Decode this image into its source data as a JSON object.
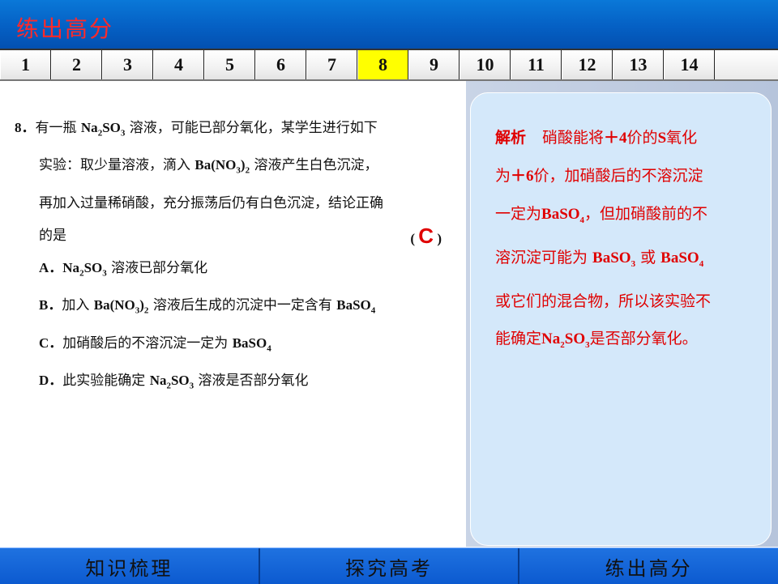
{
  "header": {
    "title": "练出高分"
  },
  "nav": {
    "items": [
      "1",
      "2",
      "3",
      "4",
      "5",
      "6",
      "7",
      "8",
      "9",
      "10",
      "11",
      "12",
      "13",
      "14"
    ],
    "active": "8"
  },
  "question": {
    "number": "8．",
    "l1_a": "有一瓶 ",
    "l1_chem": "Na",
    "l1_sub": "2",
    "l1_chem2": "SO",
    "l1_sub2": "3",
    "l1_b": " 溶液，可能已部分氧化，某学生进行如下",
    "l2_a": "实验：取少量溶液，滴入 ",
    "l2_chem": "Ba(NO",
    "l2_sub": "3",
    "l2_chem2": ")",
    "l2_sub2": "2",
    "l2_b": " 溶液产生白色沉淀，",
    "l3": "再加入过量稀硝酸，充分振荡后仍有白色沉淀，结论正确",
    "l4": "的是",
    "paren_open": "(",
    "answer": "C",
    "paren_close": ")",
    "options": {
      "a_label": "A．",
      "a_chem": "Na",
      "a_sub": "2",
      "a_chem2": "SO",
      "a_sub2": "3",
      "a_text": " 溶液已部分氧化",
      "b_label": "B．",
      "b_text1": "加入 ",
      "b_chem": "Ba(NO",
      "b_sub": "3",
      "b_chem2": ")",
      "b_sub2": "2",
      "b_text2": " 溶液后生成的沉淀中一定含有 ",
      "b_chem3": "BaSO",
      "b_sub3": "4",
      "c_label": "C．",
      "c_text": "加硝酸后的不溶沉淀一定为 ",
      "c_chem": "BaSO",
      "c_sub": "4",
      "d_label": "D．",
      "d_text1": "此实验能确定 ",
      "d_chem": "Na",
      "d_sub": "2",
      "d_chem2": "SO",
      "d_sub2": "3",
      "d_text2": " 溶液是否部分氧化"
    }
  },
  "analysis": {
    "label": "解析",
    "t1": "硝酸能将",
    "t1b": "＋4",
    "t1c": "价的",
    "t1d": "S",
    "t1e": "氧化",
    "t2": "为",
    "t2b": "＋6",
    "t2c": "价，加硝酸后的不溶沉淀",
    "t3": "一定为",
    "t3b": "BaSO",
    "t3s": "4",
    "t3c": "，但加硝酸前的不",
    "t4": "溶沉淀可能为 ",
    "t4b": "BaSO",
    "t4s": "3",
    "t4c": " 或 ",
    "t4d": "BaSO",
    "t4s2": "4",
    "t5": "或它们的混合物，所以该实验不",
    "t6": "能确定",
    "t6b": "Na",
    "t6s": "2",
    "t6b2": "SO",
    "t6s2": "3",
    "t6c": "是否部分氧化。"
  },
  "footer": {
    "items": [
      "知识梳理",
      "探究高考",
      "练出高分"
    ]
  }
}
